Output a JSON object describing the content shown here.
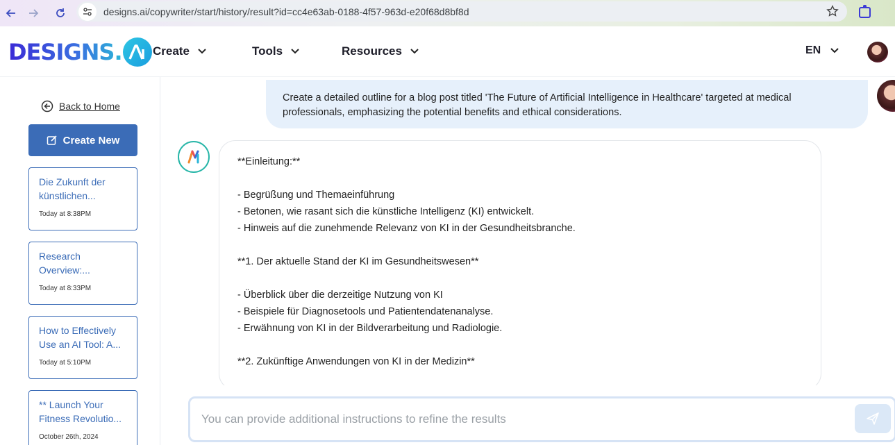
{
  "browser": {
    "url": "designs.ai/copywriter/start/history/result?id=cc4e63ab-0188-4f57-963d-e20f68d8bf8d"
  },
  "header": {
    "logo_text": "DESIGNS.",
    "menu": [
      {
        "label": "Create"
      },
      {
        "label": "Tools"
      },
      {
        "label": "Resources"
      }
    ],
    "language": "EN"
  },
  "sidebar": {
    "back_label": "Back to Home",
    "create_label": "Create New",
    "history": [
      {
        "title": "Die Zukunft der künstlichen...",
        "time": "Today at 8:38PM"
      },
      {
        "title": "Research Overview:...",
        "time": "Today at 8:33PM"
      },
      {
        "title": "How to Effectively Use an AI Tool: A...",
        "time": "Today at 5:10PM"
      },
      {
        "title": "** Launch Your Fitness Revolutio...",
        "time": "October 26th, 2024"
      }
    ]
  },
  "chat": {
    "prompt": "Create a detailed outline for a blog post titled 'The Future of Artificial Intelligence in Healthcare' targeted at medical professionals, emphasizing the potential benefits and ethical considerations.",
    "response_lines": [
      "**Einleitung:**",
      "",
      "- Begrüßung und Themaeinführung",
      "- Betonen, wie rasant sich die künstliche Intelligenz (KI) entwickelt.",
      "- Hinweis auf die zunehmende Relevanz von KI in der Gesundheitsbranche.",
      "",
      "**1. Der aktuelle Stand der KI im Gesundheitswesen**",
      "",
      "- Überblick über die derzeitige Nutzung von KI",
      "- Beispiele für Diagnosetools und Patientendatenanalyse.",
      "- Erwähnung von KI in der Bildverarbeitung und Radiologie.",
      "",
      "**2. Zukünftige Anwendungen von KI in der Medizin**",
      "",
      ""
    ],
    "input_placeholder": "You can provide additional instructions to refine the results"
  }
}
